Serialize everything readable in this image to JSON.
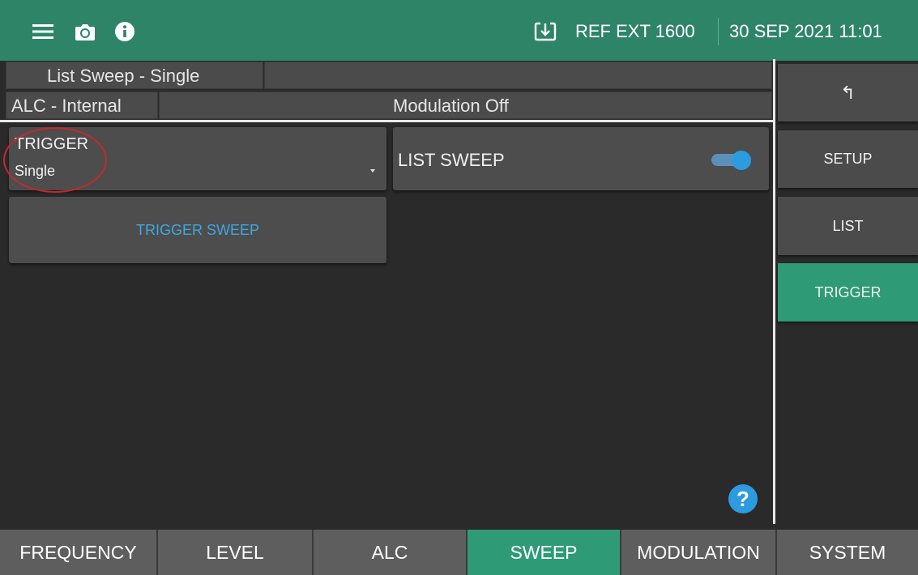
{
  "header": {
    "ref_text": "REF EXT 1600",
    "datetime": "30 SEP 2021 11:01",
    "icons": [
      "menu-icon",
      "camera-icon",
      "info-icon",
      "download-box-icon"
    ],
    "accent_color": "#2e8467"
  },
  "status": {
    "mode": "List Sweep - Single",
    "mode_extra": "",
    "alc": "ALC - Internal",
    "modulation": "Modulation Off"
  },
  "trigger": {
    "label": "TRIGGER",
    "value": "Single"
  },
  "list_sweep": {
    "label": "LIST SWEEP",
    "enabled": true
  },
  "trigger_sweep_button": "TRIGGER SWEEP",
  "help_label": "?",
  "side_menu": {
    "back_glyph": "↰",
    "items": [
      "SETUP",
      "LIST",
      "TRIGGER"
    ],
    "active": "TRIGGER"
  },
  "bottom_tabs": {
    "items": [
      "FREQUENCY",
      "LEVEL",
      "ALC",
      "SWEEP",
      "MODULATION",
      "SYSTEM"
    ],
    "active": "SWEEP"
  }
}
